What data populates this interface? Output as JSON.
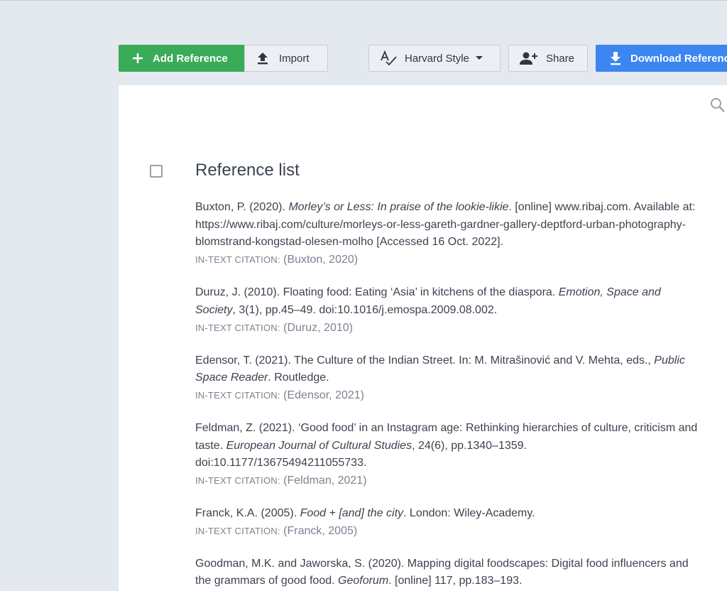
{
  "toolbar": {
    "add_reference": "Add Reference",
    "import": "Import",
    "style": "Harvard Style",
    "share": "Share",
    "download": "Download References"
  },
  "colors": {
    "add": "#3aab58",
    "download": "#3b86f0",
    "background": "#e4e8ef"
  },
  "list": {
    "title": "Reference list",
    "citation_label": "IN-TEXT CITATION:",
    "items": [
      {
        "parts": [
          {
            "text": "Buxton, P. (2020). "
          },
          {
            "text": "Morley’s or Less: In praise of the lookie-likie",
            "italic": true
          },
          {
            "text": ". [online] www.ribaj.com. Available at: https://www.ribaj.com/culture/morleys-or-less-gareth-gardner-gallery-deptford-urban-photography-blomstrand-kongstad-olesen-molho [Accessed 16 Oct. 2022]."
          }
        ],
        "citation": "(Buxton, 2020)"
      },
      {
        "parts": [
          {
            "text": "Duruz, J. (2010). Floating food: Eating ‘Asia’ in kitchens of the diaspora. "
          },
          {
            "text": "Emotion, Space and Society",
            "italic": true
          },
          {
            "text": ", 3(1), pp.45–49. doi:10.1016/j.emospa.2009.08.002."
          }
        ],
        "citation": "(Duruz, 2010)"
      },
      {
        "parts": [
          {
            "text": "Edensor, T. (2021). The Culture of the Indian Street. In: M. Mitrašinović and V. Mehta, eds., "
          },
          {
            "text": "Public Space Reader",
            "italic": true
          },
          {
            "text": ". Routledge."
          }
        ],
        "citation": "(Edensor, 2021)"
      },
      {
        "parts": [
          {
            "text": "Feldman, Z. (2021). ‘Good food’ in an Instagram age: Rethinking hierarchies of culture, criticism and taste. "
          },
          {
            "text": "European Journal of Cultural Studies",
            "italic": true
          },
          {
            "text": ", 24(6), pp.1340–1359. doi:10.1177/13675494211055733."
          }
        ],
        "citation": "(Feldman, 2021)"
      },
      {
        "parts": [
          {
            "text": "Franck, K.A. (2005). "
          },
          {
            "text": "Food + [and] the city",
            "italic": true
          },
          {
            "text": ". London: Wiley-Academy."
          }
        ],
        "citation": "(Franck, 2005)"
      },
      {
        "parts": [
          {
            "text": "Goodman, M.K. and Jaworska, S. (2020). Mapping digital foodscapes: Digital food influencers and the grammars of good food. "
          },
          {
            "text": "Geoforum",
            "italic": true
          },
          {
            "text": ". [online] 117, pp.183–193."
          }
        ],
        "citation": ""
      }
    ]
  }
}
